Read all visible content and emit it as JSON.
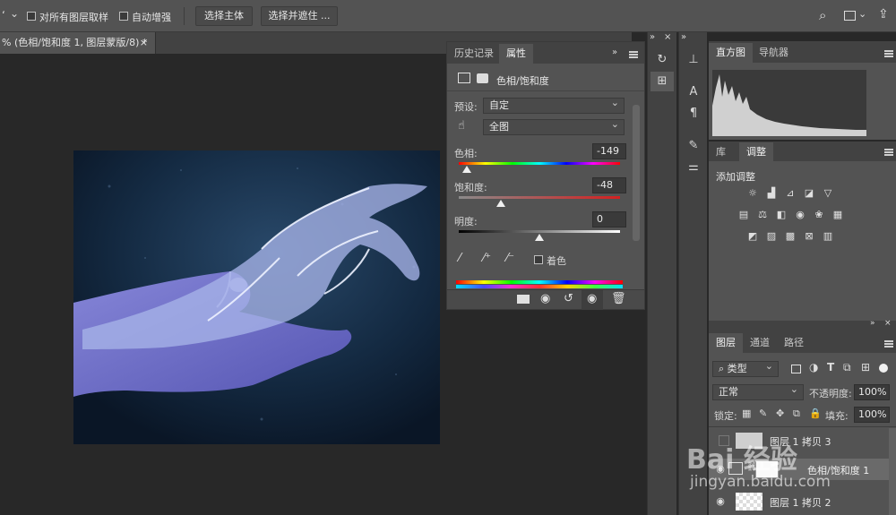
{
  "options_bar": {
    "sample_all_layers": "对所有图层取样",
    "auto_enhance": "自动增强",
    "select_subject": "选择主体",
    "select_and_mask": "选择并遮住 ..."
  },
  "document_tab": {
    "title": "% (色相/饱和度 1, 图层蒙版/8) *",
    "close": "×"
  },
  "properties_panel": {
    "tabs": [
      "历史记录",
      "属性"
    ],
    "adjustment_title": "色相/饱和度",
    "preset_label": "预设:",
    "preset_value": "自定",
    "range_value": "全图",
    "hue_label": "色相:",
    "hue_value": "-149",
    "saturation_label": "饱和度:",
    "saturation_value": "-48",
    "lightness_label": "明度:",
    "lightness_value": "0",
    "colorize_label": "着色",
    "hue_level": 0.05,
    "saturation_level": 0.26,
    "lightness_level": 0.5
  },
  "histogram_panel": {
    "tabs": [
      "直方图",
      "导航器"
    ]
  },
  "adjustments_panel": {
    "tabs": [
      "库",
      "调整"
    ],
    "add_label": "添加调整"
  },
  "layers_panel": {
    "tabs": [
      "图层",
      "通道",
      "路径"
    ],
    "filter_label": "类型",
    "blend_mode": "正常",
    "opacity_label": "不透明度:",
    "opacity_value": "100%",
    "lock_label": "锁定:",
    "fill_label": "填充:",
    "fill_value": "100%",
    "layers": [
      {
        "name": "图层 1 拷贝 3"
      },
      {
        "name": "色相/饱和度 1"
      },
      {
        "name": "图层 1 拷贝 2"
      }
    ]
  },
  "watermark": {
    "brand": "Bai 经验",
    "url": "jingyan.baidu.com"
  },
  "colors": {
    "panel": "#535353",
    "canvas_bg": "#282828",
    "selected_layer": "#6a6a6a"
  }
}
